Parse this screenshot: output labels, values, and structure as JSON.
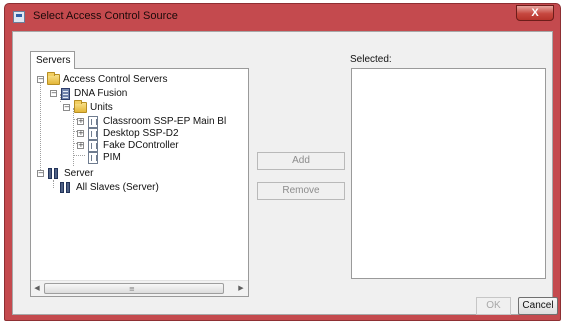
{
  "window": {
    "title": "Select Access Control Source",
    "close_label": "X"
  },
  "tabs": [
    {
      "label": "Servers",
      "selected": true
    }
  ],
  "tree": {
    "root": "Access Control Servers",
    "dna_fusion": "DNA Fusion",
    "units": "Units",
    "unit_items": [
      "Classroom SSP-EP Main Bl",
      "Desktop SSP-D2",
      "Fake DController",
      "PIM"
    ],
    "server": "Server",
    "all_slaves": "All Slaves (Server)"
  },
  "scrollbar": {
    "left_arrow": "◀",
    "right_arrow": "▶",
    "grip": "≡"
  },
  "buttons": {
    "add": "Add",
    "remove": "Remove",
    "ok": "OK",
    "cancel": "Cancel"
  },
  "selected": {
    "label": "Selected:",
    "items": []
  },
  "colors": {
    "titlebar": "#c44a4e",
    "dialog_bg": "#f0f0f0"
  }
}
